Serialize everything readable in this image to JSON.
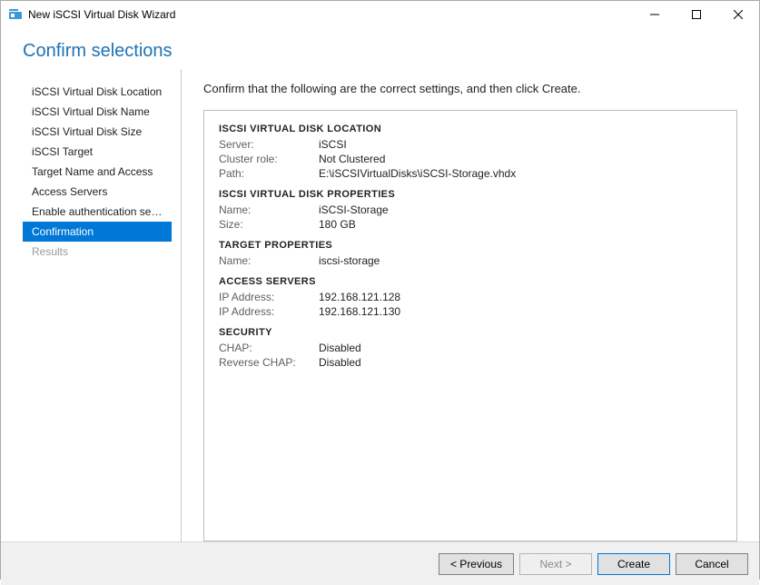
{
  "window": {
    "title": "New iSCSI Virtual Disk Wizard"
  },
  "header": {
    "title": "Confirm selections"
  },
  "sidebar": {
    "items": [
      {
        "label": "iSCSI Virtual Disk Location",
        "state": "completed"
      },
      {
        "label": "iSCSI Virtual Disk Name",
        "state": "completed"
      },
      {
        "label": "iSCSI Virtual Disk Size",
        "state": "completed"
      },
      {
        "label": "iSCSI Target",
        "state": "completed"
      },
      {
        "label": "Target Name and Access",
        "state": "completed"
      },
      {
        "label": "Access Servers",
        "state": "completed"
      },
      {
        "label": "Enable authentication ser...",
        "state": "completed"
      },
      {
        "label": "Confirmation",
        "state": "selected"
      },
      {
        "label": "Results",
        "state": "disabled"
      }
    ]
  },
  "main": {
    "instruction": "Confirm that the following are the correct settings, and then click Create.",
    "sections": {
      "location": {
        "title": "ISCSI VIRTUAL DISK LOCATION",
        "server_label": "Server:",
        "server_value": "iSCSI",
        "cluster_label": "Cluster role:",
        "cluster_value": "Not Clustered",
        "path_label": "Path:",
        "path_value": "E:\\iSCSIVirtualDisks\\iSCSI-Storage.vhdx"
      },
      "properties": {
        "title": "ISCSI VIRTUAL DISK PROPERTIES",
        "name_label": "Name:",
        "name_value": "iSCSI-Storage",
        "size_label": "Size:",
        "size_value": "180 GB"
      },
      "target": {
        "title": "TARGET PROPERTIES",
        "name_label": "Name:",
        "name_value": "iscsi-storage"
      },
      "access": {
        "title": "ACCESS SERVERS",
        "ip1_label": "IP Address:",
        "ip1_value": "192.168.121.128",
        "ip2_label": "IP Address:",
        "ip2_value": "192.168.121.130"
      },
      "security": {
        "title": "SECURITY",
        "chap_label": "CHAP:",
        "chap_value": "Disabled",
        "rchap_label": "Reverse CHAP:",
        "rchap_value": "Disabled"
      }
    }
  },
  "footer": {
    "previous": "< Previous",
    "next": "Next >",
    "create": "Create",
    "cancel": "Cancel"
  }
}
